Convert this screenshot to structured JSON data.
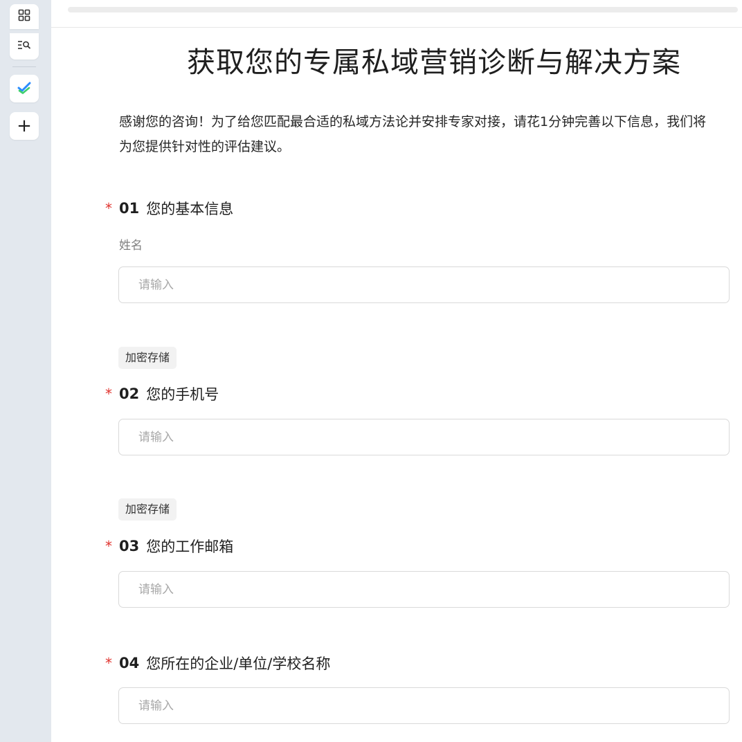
{
  "sidebar": {
    "buttons": [
      {
        "icon": "grid-icon"
      },
      {
        "icon": "list-search-icon"
      },
      {
        "icon": "check-layers-icon",
        "accent": "#2b8cff",
        "accent2": "#3ecf6e"
      },
      {
        "icon": "plus-icon",
        "glyph": "+"
      }
    ]
  },
  "form": {
    "title": "获取您的专属私域营销诊断与解决方案",
    "intro": "感谢您的咨询！为了给您匹配最合适的私域方法论并安排专家对接，请花1分钟完善以下信息，我们将为您提供针对性的评估建议。",
    "required_mark": "*",
    "questions": [
      {
        "num": "01",
        "label": "您的基本信息",
        "sublabel": "姓名",
        "placeholder": "请输入"
      },
      {
        "num": "02",
        "label": "您的手机号",
        "tag": "加密存储",
        "placeholder": "请输入"
      },
      {
        "num": "03",
        "label": "您的工作邮箱",
        "tag": "加密存储",
        "placeholder": "请输入"
      },
      {
        "num": "04",
        "label": "您所在的企业/单位/学校名称",
        "placeholder": "请输入"
      }
    ]
  },
  "colors": {
    "required": "#e0342f",
    "sidebar_bg": "#e3e8ee",
    "border": "#d9d9d9"
  }
}
